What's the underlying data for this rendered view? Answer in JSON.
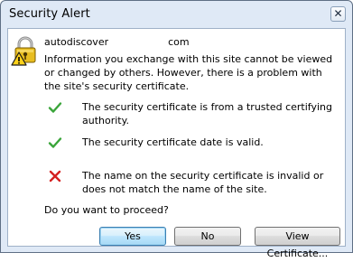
{
  "window": {
    "title": "Security Alert",
    "close_glyph": "✕"
  },
  "site": {
    "prefix": "autodiscover",
    "suffix": "com"
  },
  "info_text": "Information you exchange with this site cannot be viewed or changed by others. However, there is a problem with the site's security certificate.",
  "checks": [
    {
      "status": "ok",
      "icon": "check-icon",
      "text": "The security certificate is from a trusted certifying authority."
    },
    {
      "status": "ok",
      "icon": "check-icon",
      "text": "The security certificate date is valid."
    },
    {
      "status": "error",
      "icon": "error-x-icon",
      "text": "The name on the security certificate is invalid or does not match the name of the site."
    }
  ],
  "question": "Do you want to proceed?",
  "buttons": {
    "yes": "Yes",
    "no": "No",
    "view_certificate": "View Certificate..."
  },
  "colors": {
    "frame": "#dfe9f6",
    "ok_green": "#3aa53a",
    "error_red": "#d42020",
    "lock_gold": "#e0b400"
  }
}
